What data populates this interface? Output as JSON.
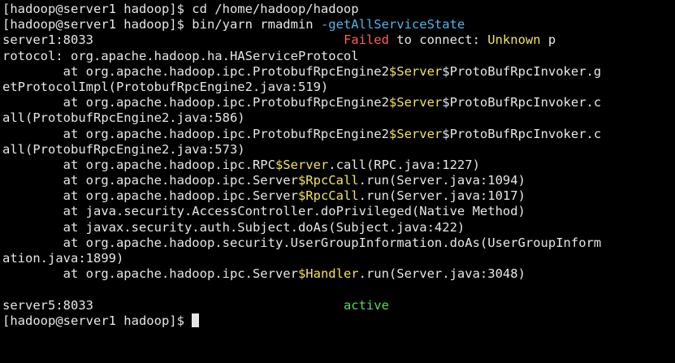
{
  "terminal": {
    "lines": [
      [
        {
          "t": "[hadoop@server1 hadoop]$ cd /home/hadoop/hadoop",
          "c": "white"
        }
      ],
      [
        {
          "t": "[hadoop@server1 hadoop]$ bin/yarn rmadmin ",
          "c": "white"
        },
        {
          "t": "-getAllServiceState",
          "c": "cyan"
        }
      ],
      [
        {
          "t": "server1:8033                                 ",
          "c": "white"
        },
        {
          "t": "Failed",
          "c": "red"
        },
        {
          "t": " to connect: ",
          "c": "white"
        },
        {
          "t": "Unknown",
          "c": "yellow"
        },
        {
          "t": " p",
          "c": "white"
        }
      ],
      [
        {
          "t": "rotocol: org.apache.hadoop.ha.HAServiceProtocol",
          "c": "white"
        }
      ],
      [
        {
          "t": "        at org.apache.hadoop.ipc.ProtobufRpcEngine2",
          "c": "white"
        },
        {
          "t": "$Server",
          "c": "yellow"
        },
        {
          "t": "$ProtoBufRpcInvoker.g",
          "c": "white"
        }
      ],
      [
        {
          "t": "etProtocolImpl(ProtobufRpcEngine2.java:519)",
          "c": "white"
        }
      ],
      [
        {
          "t": "        at org.apache.hadoop.ipc.ProtobufRpcEngine2",
          "c": "white"
        },
        {
          "t": "$Server",
          "c": "yellow"
        },
        {
          "t": "$ProtoBufRpcInvoker.c",
          "c": "white"
        }
      ],
      [
        {
          "t": "all(ProtobufRpcEngine2.java:586)",
          "c": "white"
        }
      ],
      [
        {
          "t": "        at org.apache.hadoop.ipc.ProtobufRpcEngine2",
          "c": "white"
        },
        {
          "t": "$Server",
          "c": "yellow"
        },
        {
          "t": "$ProtoBufRpcInvoker.c",
          "c": "white"
        }
      ],
      [
        {
          "t": "all(ProtobufRpcEngine2.java:573)",
          "c": "white"
        }
      ],
      [
        {
          "t": "        at org.apache.hadoop.ipc.RPC",
          "c": "white"
        },
        {
          "t": "$Server",
          "c": "yellow"
        },
        {
          "t": ".call(RPC.java:1227)",
          "c": "white"
        }
      ],
      [
        {
          "t": "        at org.apache.hadoop.ipc.Server",
          "c": "white"
        },
        {
          "t": "$RpcCall",
          "c": "yellow"
        },
        {
          "t": ".run(Server.java:1094)",
          "c": "white"
        }
      ],
      [
        {
          "t": "        at org.apache.hadoop.ipc.Server",
          "c": "white"
        },
        {
          "t": "$RpcCall",
          "c": "yellow"
        },
        {
          "t": ".run(Server.java:1017)",
          "c": "white"
        }
      ],
      [
        {
          "t": "        at java.security.AccessController.doPrivileged(Native Method)",
          "c": "white"
        }
      ],
      [
        {
          "t": "        at javax.security.auth.Subject.doAs(Subject.java:422)",
          "c": "white"
        }
      ],
      [
        {
          "t": "        at org.apache.hadoop.security.UserGroupInformation.doAs(UserGroupInform",
          "c": "white"
        }
      ],
      [
        {
          "t": "ation.java:1899)",
          "c": "white"
        }
      ],
      [
        {
          "t": "        at org.apache.hadoop.ipc.Server",
          "c": "white"
        },
        {
          "t": "$Handler",
          "c": "yellow"
        },
        {
          "t": ".run(Server.java:3048)",
          "c": "white"
        }
      ],
      [
        {
          "t": "",
          "c": "white"
        }
      ],
      [
        {
          "t": "server5:8033                                 ",
          "c": "white"
        },
        {
          "t": "active",
          "c": "green"
        }
      ],
      [
        {
          "t": "[hadoop@server1 hadoop]$ ",
          "c": "white"
        }
      ]
    ]
  },
  "colors": {
    "background": "#000000",
    "text": "#e6e6e6",
    "error": "#ff5f5f",
    "highlight": "#f2e35a",
    "option": "#4fb6e8",
    "success": "#5fd75f"
  }
}
